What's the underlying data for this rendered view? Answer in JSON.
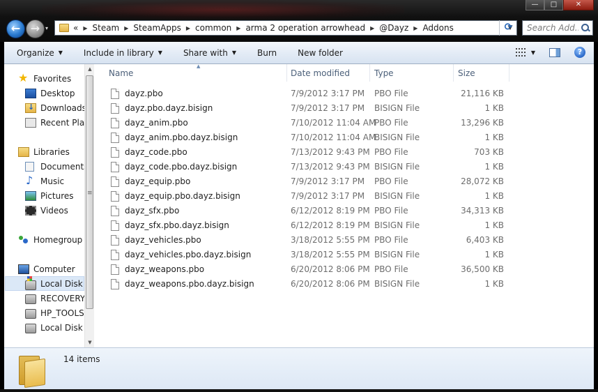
{
  "window": {
    "minimize_label": "—",
    "maximize_label": "□",
    "close_label": "✕"
  },
  "nav": {
    "back_label": "←",
    "forward_label": "→",
    "recent_label": "▾"
  },
  "address": {
    "overflow_label": "«",
    "crumbs": [
      "Steam",
      "SteamApps",
      "common",
      "arma 2 operation arrowhead",
      "@Dayz",
      "Addons"
    ],
    "refresh_label": "⟳"
  },
  "search": {
    "placeholder": "Search Add..."
  },
  "toolbar": {
    "organize": "Organize",
    "include_in_library": "Include in library",
    "share_with": "Share with",
    "burn": "Burn",
    "new_folder": "New folder",
    "help_label": "?"
  },
  "sidebar": {
    "favorites": "Favorites",
    "desktop": "Desktop",
    "downloads": "Downloads",
    "recent_places": "Recent Plac",
    "libraries": "Libraries",
    "documents": "Documents",
    "music": "Music",
    "pictures": "Pictures",
    "videos": "Videos",
    "homegroup": "Homegroup",
    "computer": "Computer",
    "local_disk_c": "Local Disk (",
    "recovery": "RECOVERY (",
    "hp_tools": "HP_TOOLS",
    "local_disk_2": "Local Disk ("
  },
  "columns": {
    "name": "Name",
    "date_modified": "Date modified",
    "type": "Type",
    "size": "Size"
  },
  "files": [
    {
      "name": "dayz.pbo",
      "date": "7/9/2012 3:17 PM",
      "type": "PBO File",
      "size": "21,116 KB"
    },
    {
      "name": "dayz.pbo.dayz.bisign",
      "date": "7/9/2012 3:17 PM",
      "type": "BISIGN File",
      "size": "1 KB"
    },
    {
      "name": "dayz_anim.pbo",
      "date": "7/10/2012 11:04 AM",
      "type": "PBO File",
      "size": "13,296 KB"
    },
    {
      "name": "dayz_anim.pbo.dayz.bisign",
      "date": "7/10/2012 11:04 AM",
      "type": "BISIGN File",
      "size": "1 KB"
    },
    {
      "name": "dayz_code.pbo",
      "date": "7/13/2012 9:43 PM",
      "type": "PBO File",
      "size": "703 KB"
    },
    {
      "name": "dayz_code.pbo.dayz.bisign",
      "date": "7/13/2012 9:43 PM",
      "type": "BISIGN File",
      "size": "1 KB"
    },
    {
      "name": "dayz_equip.pbo",
      "date": "7/9/2012 3:17 PM",
      "type": "PBO File",
      "size": "28,072 KB"
    },
    {
      "name": "dayz_equip.pbo.dayz.bisign",
      "date": "7/9/2012 3:17 PM",
      "type": "BISIGN File",
      "size": "1 KB"
    },
    {
      "name": "dayz_sfx.pbo",
      "date": "6/12/2012 8:19 PM",
      "type": "PBO File",
      "size": "34,313 KB"
    },
    {
      "name": "dayz_sfx.pbo.dayz.bisign",
      "date": "6/12/2012 8:19 PM",
      "type": "BISIGN File",
      "size": "1 KB"
    },
    {
      "name": "dayz_vehicles.pbo",
      "date": "3/18/2012 5:55 PM",
      "type": "PBO File",
      "size": "6,403 KB"
    },
    {
      "name": "dayz_vehicles.pbo.dayz.bisign",
      "date": "3/18/2012 5:55 PM",
      "type": "BISIGN File",
      "size": "1 KB"
    },
    {
      "name": "dayz_weapons.pbo",
      "date": "6/20/2012 8:06 PM",
      "type": "PBO File",
      "size": "36,500 KB"
    },
    {
      "name": "dayz_weapons.pbo.dayz.bisign",
      "date": "6/20/2012 8:06 PM",
      "type": "BISIGN File",
      "size": "1 KB"
    }
  ],
  "details": {
    "item_count": "14 items"
  }
}
